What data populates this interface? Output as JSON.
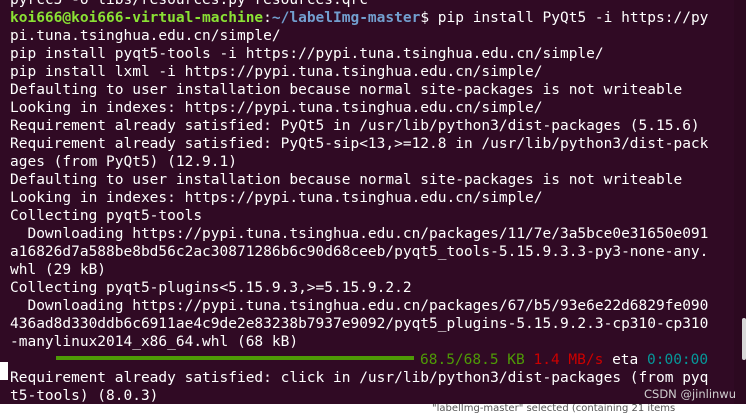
{
  "terminal": {
    "prompt": {
      "user_host": "koi666@koi666-virtual-machine",
      "path": "~/labelImg-master",
      "symbol": "$ "
    },
    "lines": [
      "pyrcc5 -o libs/resources.py resources.qrc",
      "PROMPT_LINE",
      "pi.tuna.tsinghua.edu.cn/simple/",
      "pip install pyqt5-tools -i https://pypi.tuna.tsinghua.edu.cn/simple/",
      "pip install lxml -i https://pypi.tuna.tsinghua.edu.cn/simple/",
      "Defaulting to user installation because normal site-packages is not writeable",
      "Looking in indexes: https://pypi.tuna.tsinghua.edu.cn/simple/",
      "Requirement already satisfied: PyQt5 in /usr/lib/python3/dist-packages (5.15.6)",
      "Requirement already satisfied: PyQt5-sip<13,>=12.8 in /usr/lib/python3/dist-pack",
      "ages (from PyQt5) (12.9.1)",
      "Defaulting to user installation because normal site-packages is not writeable",
      "Looking in indexes: https://pypi.tuna.tsinghua.edu.cn/simple/",
      "Collecting pyqt5-tools",
      "  Downloading https://pypi.tuna.tsinghua.edu.cn/packages/11/7e/3a5bce0e31650e091",
      "a16826d7a588be8bd56c2ac30871286b6c90d68ceeb/pyqt5_tools-5.15.9.3.3-py3-none-any.",
      "whl (29 kB)",
      "Collecting pyqt5-plugins<5.15.9.3,>=5.15.9.2.2",
      "  Downloading https://pypi.tuna.tsinghua.edu.cn/packages/67/b5/93e6e22d6829fe090",
      "436ad8d330ddb6c6911ae4c9de2e83238b7937e9092/pyqt5_plugins-5.15.9.2.3-cp310-cp310",
      "-manylinux2014_x86_64.whl (68 kB)",
      "PROGRESS_LINE",
      "Requirement already satisfied: click in /usr/lib/python3/dist-packages (from pyq",
      "t5-tools) (8.0.3)"
    ],
    "command": "pip install PyQt5 -i https://py",
    "progress": {
      "fraction": 1.0,
      "size": "68.5/68.5 KB",
      "speed": "1.4 MB/s",
      "eta_label": "eta",
      "eta": "0:00:00"
    }
  },
  "watermark": "CSDN @jinlinwu",
  "background_status": "\"labelImg-master\" selected  (containing 21 items"
}
